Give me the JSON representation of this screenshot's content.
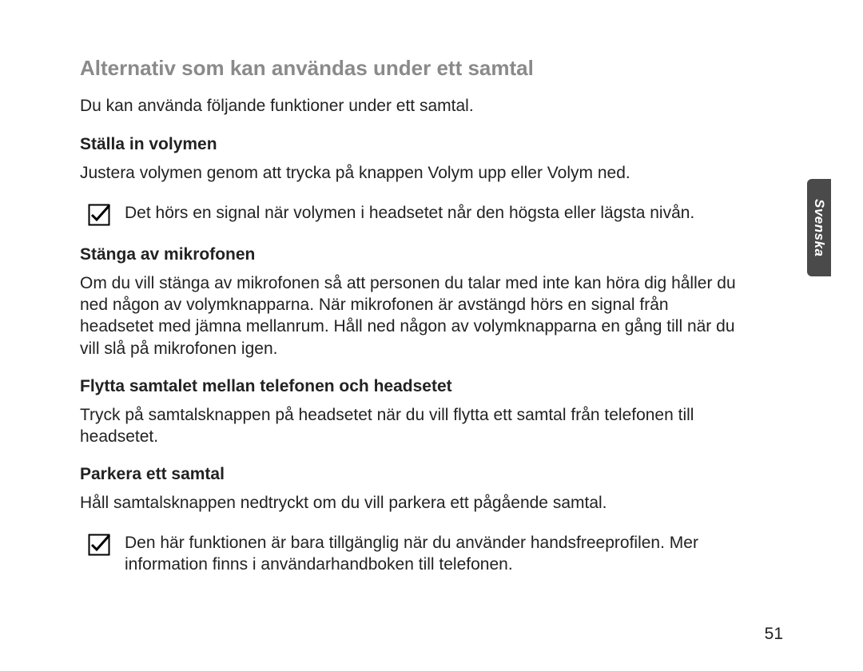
{
  "language_tab": "Svenska",
  "title": "Alternativ som kan användas under ett samtal",
  "intro": "Du kan använda följande funktioner under ett samtal.",
  "sections": [
    {
      "heading": "Ställa in volymen",
      "body": "Justera volymen genom att trycka på knappen Volym upp eller Volym ned.",
      "note": "Det hörs en signal när volymen i headsetet når den högsta eller lägsta nivån."
    },
    {
      "heading": "Stänga av mikrofonen",
      "body": "Om du vill stänga av mikrofonen så att personen du talar med inte kan höra dig håller du ned någon av volymknapparna. När mikrofonen är avstängd hörs en signal från headsetet med jämna mellanrum. Håll ned någon av volymknapparna en gång till när du vill slå på mikrofonen igen."
    },
    {
      "heading": "Flytta samtalet mellan telefonen och headsetet",
      "body": "Tryck på samtalsknappen på headsetet när du vill flytta ett samtal från telefonen till headsetet."
    },
    {
      "heading": "Parkera ett samtal",
      "body": "Håll samtalsknappen nedtryckt om du vill parkera ett pågående samtal.",
      "note": "Den här funktionen är bara tillgänglig när du använder handsfreeprofilen. Mer information finns i användarhandboken till telefonen."
    }
  ],
  "page_number": "51"
}
